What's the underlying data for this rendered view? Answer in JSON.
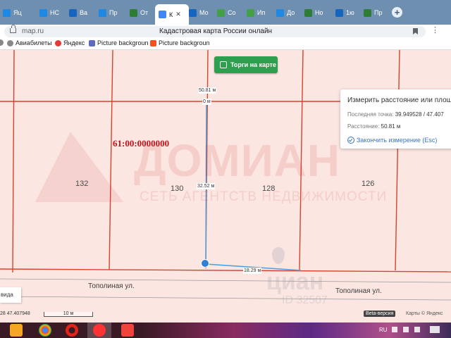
{
  "tabs": [
    {
      "label": "Яц",
      "icon": "yandex-zen-icon",
      "color": "#1e88e5"
    },
    {
      "label": "НС",
      "icon": "tab-icon",
      "color": "#1e88e5"
    },
    {
      "label": "Ва",
      "icon": "avito-icon",
      "color": "#1565c0"
    },
    {
      "label": "Пр",
      "icon": "tab-icon",
      "color": "#1e88e5"
    },
    {
      "label": "От",
      "icon": "tab-icon",
      "color": "#2e7d32"
    },
    {
      "label": "К",
      "icon": "map-icon",
      "color": "#4285f4",
      "active": true
    },
    {
      "label": "Мо",
      "icon": "tab-icon",
      "color": "#1565c0"
    },
    {
      "label": "Со",
      "icon": "tab-icon",
      "color": "#43a047"
    },
    {
      "label": "Ип",
      "icon": "tab-icon",
      "color": "#43a047"
    },
    {
      "label": "До",
      "icon": "tab-icon",
      "color": "#1e88e5"
    },
    {
      "label": "Но",
      "icon": "tab-icon",
      "color": "#2e7d32"
    },
    {
      "label": "1ю",
      "icon": "tab-icon",
      "color": "#1565c0"
    },
    {
      "label": "Пр",
      "icon": "tab-icon",
      "color": "#2e7d32"
    }
  ],
  "tab_close": "✕",
  "new_tab": "+",
  "address": {
    "url": "map.ru",
    "title": "Кадастровая карта России онлайн"
  },
  "bookmarks": [
    {
      "label": "Авиабилеты",
      "icon": "gear-icon",
      "color": "#888888"
    },
    {
      "label": "Яндекс",
      "icon": "yandex-icon",
      "color": "#e53935"
    },
    {
      "label": "Picture backgroun",
      "icon": "picture-icon",
      "color": "#5c6bc0"
    },
    {
      "label": "Picture backgroun",
      "icon": "picture-icon",
      "color": "#f4511e"
    }
  ],
  "map": {
    "torgi_button": "Торги на карте",
    "cadastral_number": "61:00:0000000",
    "plots": [
      "132",
      "130",
      "128",
      "126"
    ],
    "watermark_brand": "ДОМИАН",
    "watermark_sub": "СЕТЬ АГЕНТСТВ НЕДВИЖИМОСТИ",
    "watermark_cian": "циан",
    "watermark_id": "ID 32507",
    "measure_labels": {
      "top": "50.81 м",
      "start": "0 м",
      "middle": "32.52 м",
      "bottom": "18.29 м"
    },
    "streets": [
      "Тополиная ул.",
      "Тополиная ул."
    ],
    "left_control": "вида",
    "coords": "28   47.407948",
    "scale_label": "10 м",
    "beta_label": "Beta-версия",
    "attribution": "Карты © Яндекс"
  },
  "measure_panel": {
    "title": "Измерить расстояние или площадь",
    "last_point_label": "Последняя точка:",
    "last_point_value": "39.949528 / 47.407",
    "distance_label": "Расстояние:",
    "distance_value": "50.81 м",
    "finish_label": "Закончить измерение (Esc)"
  },
  "taskbar": {
    "apps": [
      "media-player-icon",
      "chrome-icon",
      "opera-icon",
      "yandex-browser-icon",
      "anydesk-icon"
    ],
    "lang": "RU"
  },
  "colors": {
    "map_bg": "#fbe6e2",
    "parcel_border": "#d9432c",
    "measure_line": "#4a9fe0",
    "torgi_green": "#2d9f4e",
    "cadastral_red": "#c0141b"
  }
}
